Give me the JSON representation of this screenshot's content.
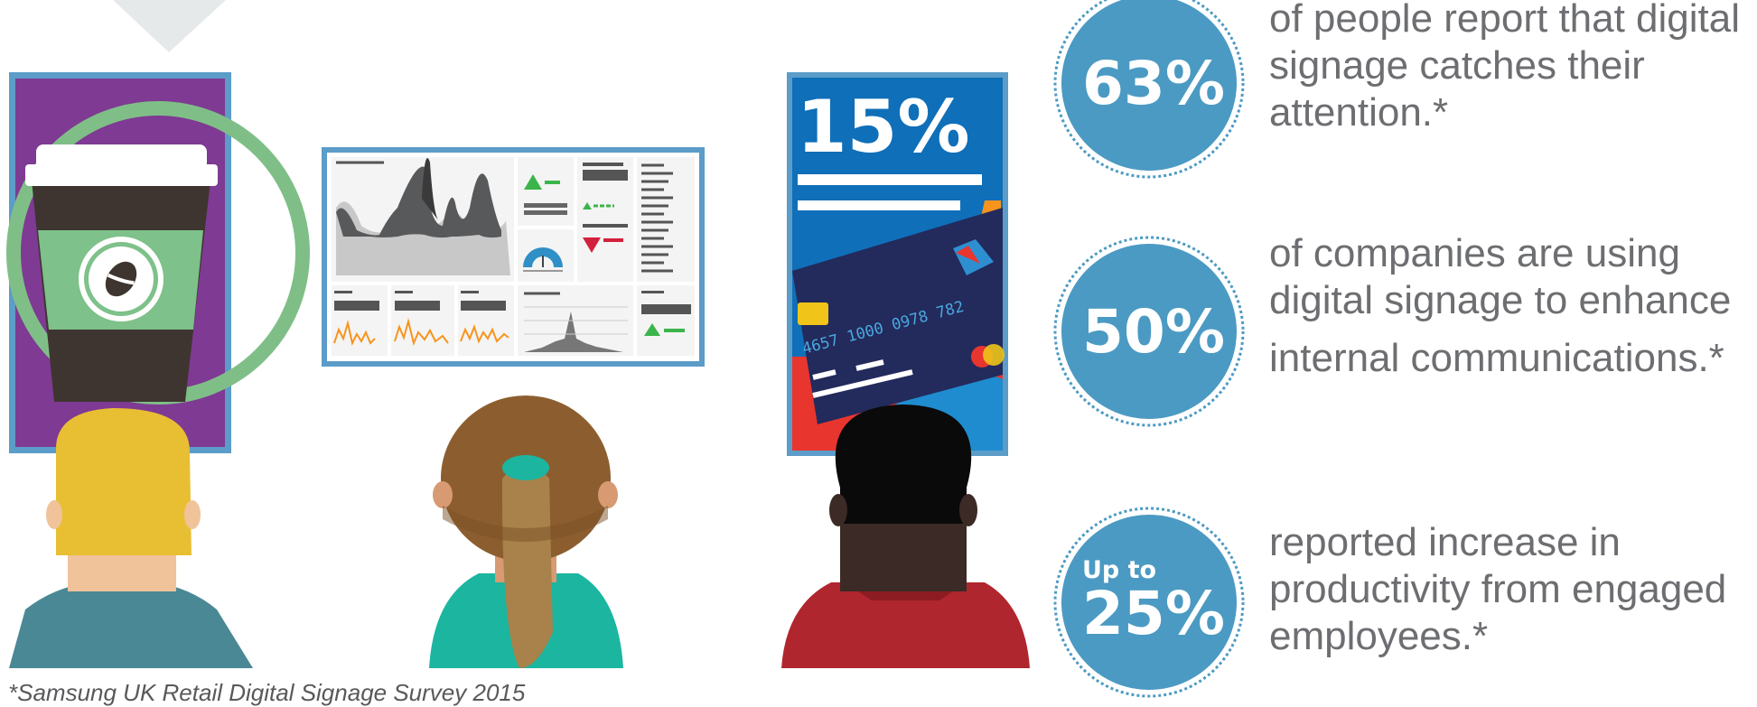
{
  "stats": [
    {
      "prefix": "",
      "value": "63%",
      "text_lines": [
        "of people report that digital",
        "signage catches their",
        "attention.*"
      ]
    },
    {
      "prefix": "",
      "value": "50%",
      "text_lines": [
        "of companies are using",
        "digital signage to enhance",
        "internal communications.*"
      ]
    },
    {
      "prefix": "Up to",
      "value": "25%",
      "text_lines": [
        "reported increase in",
        "productivity from engaged",
        "employees.*"
      ]
    }
  ],
  "card_screen": {
    "headline": "15%",
    "card_number": "4657 1000 0978 782"
  },
  "footnote": "*Samsung UK Retail Digital Signage Survey 2015",
  "colors": {
    "circle": "#4b9ac3",
    "frame": "#5b9cc8",
    "coffee_bg": "#7f3a93",
    "card_bg": "#0f6fb8",
    "text_gray": "#6d6e71"
  }
}
